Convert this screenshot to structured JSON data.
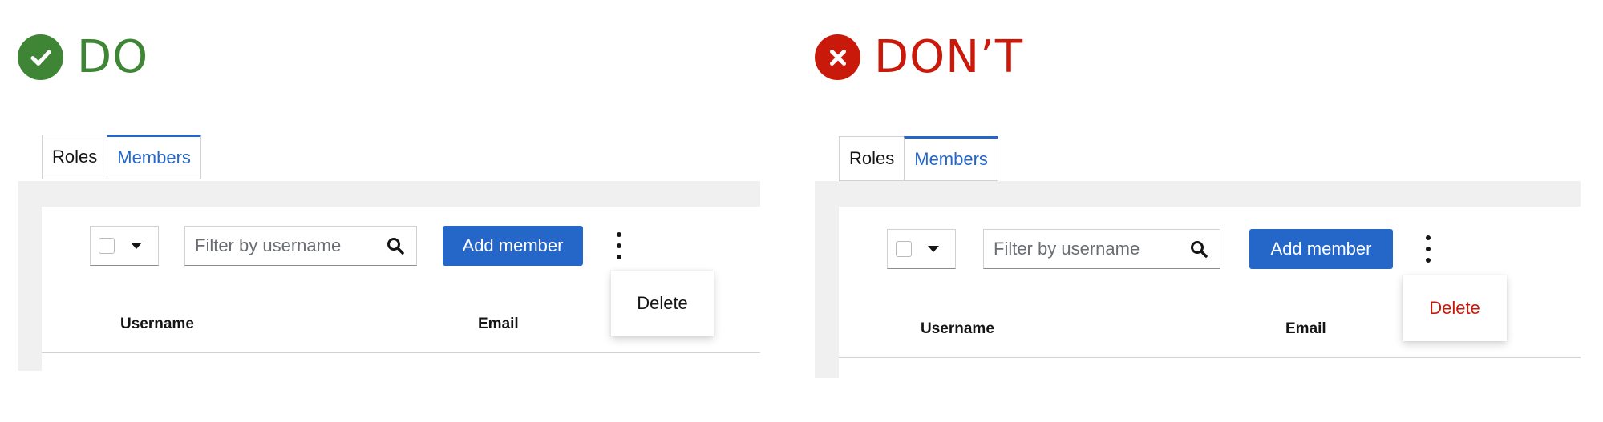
{
  "do": {
    "heading": "DO",
    "tabs": [
      "Roles",
      "Members"
    ],
    "filter_placeholder": "Filter by username",
    "add_button": "Add member",
    "menu_item": "Delete",
    "columns": [
      "Username",
      "Email"
    ],
    "accent": "#3e8635",
    "menu_item_color": "#151515"
  },
  "dont": {
    "heading": "DON’T",
    "tabs": [
      "Roles",
      "Members"
    ],
    "filter_placeholder": "Filter by username",
    "add_button": "Add member",
    "menu_item": "Delete",
    "columns": [
      "Username",
      "Email"
    ],
    "accent": "#c9190b",
    "menu_item_color": "#c9190b"
  },
  "colors": {
    "primary_blue": "#2467c9",
    "border": "#d2d2d2",
    "gutter": "#f0f0f0"
  },
  "icons": {
    "do": "check-circle-icon",
    "dont": "times-circle-icon",
    "search": "search-icon",
    "kebab": "kebab-icon",
    "caret": "caret-down-icon"
  }
}
